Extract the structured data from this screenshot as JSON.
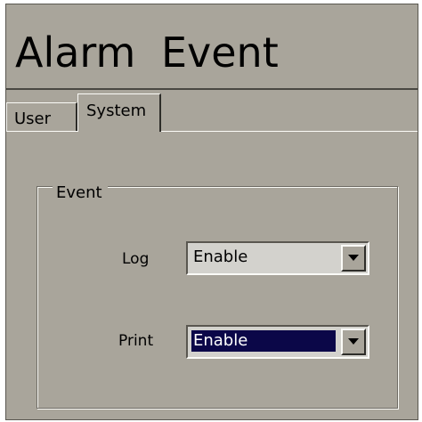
{
  "window": {
    "title": "Alarm  Event"
  },
  "tabs": [
    {
      "label": "User"
    },
    {
      "label": "System"
    }
  ],
  "event_group": {
    "legend": "Event",
    "log": {
      "label": "Log",
      "value": "Enable"
    },
    "print": {
      "label": "Print",
      "value": "Enable"
    }
  },
  "icons": {
    "dropdown": "chevron-down-icon"
  },
  "colors": {
    "panel": "#a9a59b",
    "selection": "#0b0748"
  }
}
